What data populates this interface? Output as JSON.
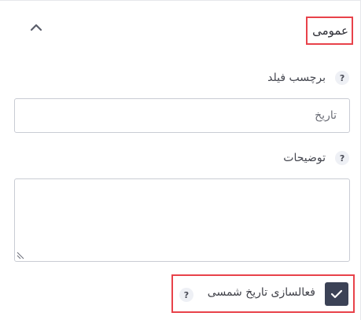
{
  "section": {
    "title": "عمومی"
  },
  "fields": {
    "label": {
      "label": "برچسب فیلد",
      "help": "?",
      "value": "تاریخ"
    },
    "description": {
      "label": "توضیحات",
      "help": "?",
      "value": ""
    },
    "shamsi": {
      "label": "فعالسازی تاریخ شمسی",
      "help": "?",
      "checked": true
    }
  },
  "colors": {
    "highlight": "#e8424a",
    "checkbox": "#3b4256"
  },
  "icons": {
    "collapse": "chevron-up-icon",
    "check": "check-icon",
    "grip": "resize-grip-icon"
  }
}
